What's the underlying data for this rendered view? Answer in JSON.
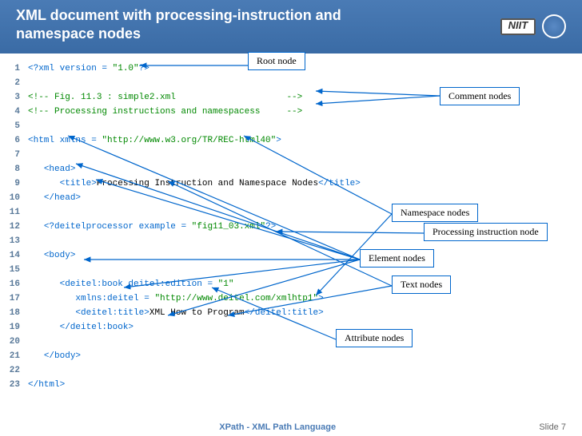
{
  "header": {
    "title_line1": "XML document with processing-instruction and",
    "title_line2": "namespace nodes",
    "logo": "NIIT"
  },
  "code": {
    "lines": [
      {
        "n": "1",
        "parts": [
          {
            "c": "pi",
            "t": "<?xml version = "
          },
          {
            "c": "str",
            "t": "\"1.0\""
          },
          {
            "c": "pi",
            "t": "?>"
          }
        ]
      },
      {
        "n": "2",
        "parts": []
      },
      {
        "n": "3",
        "parts": [
          {
            "c": "cmt",
            "t": "<!-- Fig. 11.3 : simple2.xml                     -->"
          }
        ]
      },
      {
        "n": "4",
        "parts": [
          {
            "c": "cmt",
            "t": "<!-- Processing instructions and namespacess     -->"
          }
        ]
      },
      {
        "n": "5",
        "parts": []
      },
      {
        "n": "6",
        "parts": [
          {
            "c": "tag",
            "t": "<html xmlns = "
          },
          {
            "c": "str",
            "t": "\"http://www.w3.org/TR/REC-html40\""
          },
          {
            "c": "tag",
            "t": ">"
          }
        ]
      },
      {
        "n": "7",
        "parts": []
      },
      {
        "n": "8",
        "parts": [
          {
            "c": "",
            "t": "   "
          },
          {
            "c": "tag",
            "t": "<head>"
          }
        ]
      },
      {
        "n": "9",
        "parts": [
          {
            "c": "",
            "t": "      "
          },
          {
            "c": "tag",
            "t": "<title>"
          },
          {
            "c": "txt",
            "t": "Processing Instruction and Namespace Nodes"
          },
          {
            "c": "tag",
            "t": "</title>"
          }
        ]
      },
      {
        "n": "10",
        "parts": [
          {
            "c": "",
            "t": "   "
          },
          {
            "c": "tag",
            "t": "</head>"
          }
        ]
      },
      {
        "n": "11",
        "parts": []
      },
      {
        "n": "12",
        "parts": [
          {
            "c": "",
            "t": "   "
          },
          {
            "c": "pi",
            "t": "<?deitelprocessor example = "
          },
          {
            "c": "str",
            "t": "\"fig11_03.xml\""
          },
          {
            "c": "pi",
            "t": "?>"
          }
        ]
      },
      {
        "n": "13",
        "parts": []
      },
      {
        "n": "14",
        "parts": [
          {
            "c": "",
            "t": "   "
          },
          {
            "c": "tag",
            "t": "<body>"
          }
        ]
      },
      {
        "n": "15",
        "parts": []
      },
      {
        "n": "16",
        "parts": [
          {
            "c": "",
            "t": "      "
          },
          {
            "c": "tag",
            "t": "<deitel:book deitel:edition = "
          },
          {
            "c": "str",
            "t": "\"1\""
          }
        ]
      },
      {
        "n": "17",
        "parts": [
          {
            "c": "",
            "t": "         "
          },
          {
            "c": "tag",
            "t": "xmlns:deitel = "
          },
          {
            "c": "str",
            "t": "\"http://www.deitel.com/xmlhtp1\""
          },
          {
            "c": "tag",
            "t": ">"
          }
        ]
      },
      {
        "n": "18",
        "parts": [
          {
            "c": "",
            "t": "         "
          },
          {
            "c": "tag",
            "t": "<deitel:title>"
          },
          {
            "c": "txt",
            "t": "XML How to Program"
          },
          {
            "c": "tag",
            "t": "</deitel:title>"
          }
        ]
      },
      {
        "n": "19",
        "parts": [
          {
            "c": "",
            "t": "      "
          },
          {
            "c": "tag",
            "t": "</deitel:book>"
          }
        ]
      },
      {
        "n": "20",
        "parts": []
      },
      {
        "n": "21",
        "parts": [
          {
            "c": "",
            "t": "   "
          },
          {
            "c": "tag",
            "t": "</body>"
          }
        ]
      },
      {
        "n": "22",
        "parts": []
      },
      {
        "n": "23",
        "parts": [
          {
            "c": "tag",
            "t": "</html>"
          }
        ]
      }
    ]
  },
  "labels": {
    "root": "Root node",
    "comment": "Comment nodes",
    "namespace": "Namespace nodes",
    "processing": "Processing instruction node",
    "element": "Element nodes",
    "text": "Text nodes",
    "attribute": "Attribute nodes"
  },
  "footer": {
    "center": "XPath - XML Path Language",
    "right_label": "Slide ",
    "right_num": "7"
  }
}
